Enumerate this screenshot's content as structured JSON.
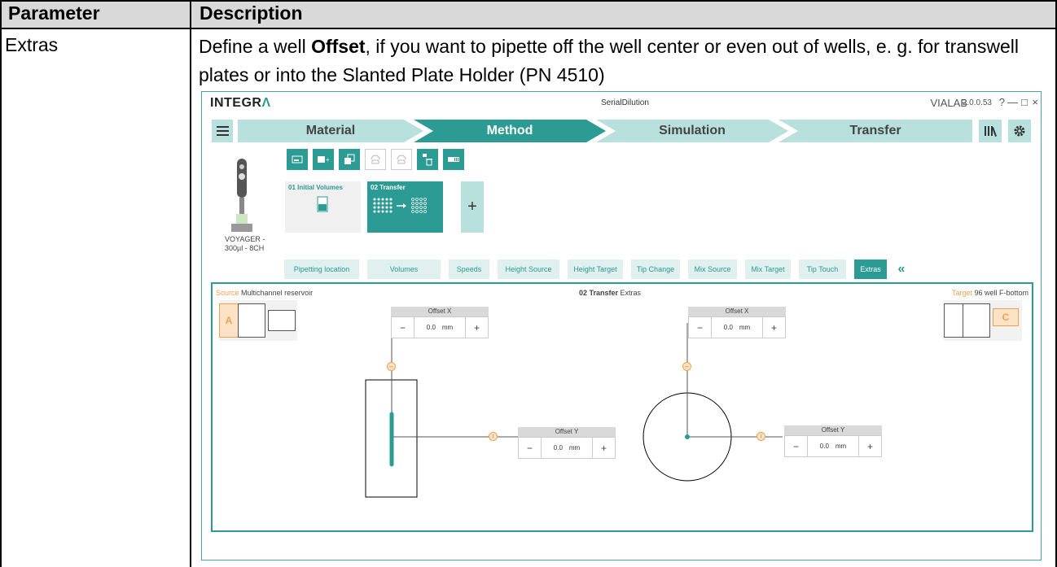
{
  "table": {
    "header": {
      "param": "Parameter",
      "desc": "Description"
    },
    "row": {
      "param": "Extras",
      "desc_pre": "Define a well ",
      "desc_bold": "Offset",
      "desc_post": ", if you want to pipette off the well center or even out of wells, e. g. for transwell plates or into the Slanted Plate Holder (PN 4510)"
    }
  },
  "app": {
    "logo_text": "INTEGR",
    "logo_accent": "Λ",
    "window_title": "SerialDilution",
    "product": "VIALAB",
    "version": "2.0.0.53",
    "help": "?",
    "minimize": "—",
    "maximize": "□",
    "close": "×",
    "steps": [
      "Material",
      "Method",
      "Simulation",
      "Transfer"
    ],
    "active_step": "Method",
    "pipette_label_1": "VOYAGER -",
    "pipette_label_2": "300µl - 8CH",
    "cards": [
      {
        "title": "01 Initial Volumes"
      },
      {
        "title": "02 Transfer"
      }
    ],
    "add_card": "+",
    "tabs": [
      "Pipetting location",
      "Volumes",
      "Speeds",
      "Height Source",
      "Height Target",
      "Tip Change",
      "Mix Source",
      "Mix Target",
      "Tip Touch",
      "Extras"
    ],
    "active_tab": "Extras",
    "collapse": "«",
    "source_key": "Source",
    "source_name": "Multichannel reservoir",
    "target_key": "Target",
    "target_name": "96 well F-bottom",
    "panel_title_bold": "02 Transfer",
    "panel_title_rest": " Extras",
    "source_slot": "A",
    "target_slot": "C",
    "offset_x_label": "Offset X",
    "offset_y_label": "Offset Y",
    "minus": "−",
    "plus": "+",
    "offset_value": "0.0",
    "unit": "mm"
  },
  "colors": {
    "accent": "#2b9b93",
    "accent_light": "#b8e0dc",
    "orange": "#f0a050"
  }
}
